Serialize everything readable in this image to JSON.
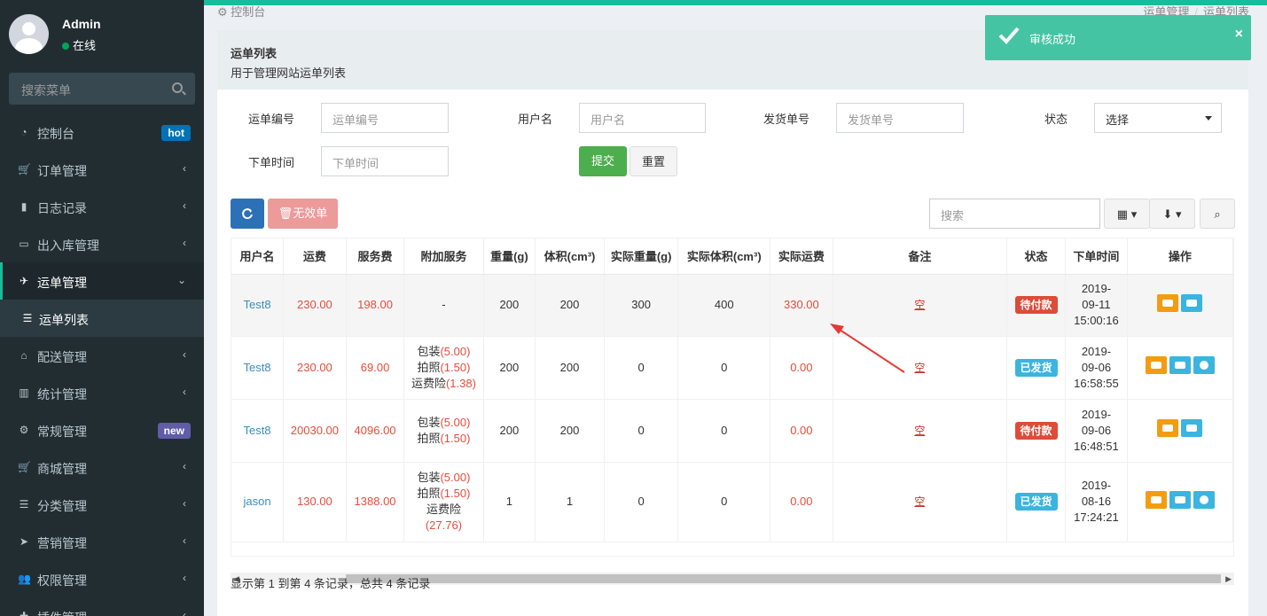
{
  "sidebar": {
    "user_name": "Admin",
    "user_status": "在线",
    "search_placeholder": "搜索菜单",
    "items": [
      {
        "label": "控制台",
        "icon": "dashboard-icon",
        "badge": "hot"
      },
      {
        "label": "订单管理",
        "icon": "cart-icon"
      },
      {
        "label": "日志记录",
        "icon": "book-icon"
      },
      {
        "label": "出入库管理",
        "icon": "inbox-icon"
      },
      {
        "label": "运单管理",
        "icon": "plane-icon",
        "active": true
      },
      {
        "label": "运单列表",
        "icon": "list-icon",
        "sub": true
      },
      {
        "label": "配送管理",
        "icon": "bank-icon"
      },
      {
        "label": "统计管理",
        "icon": "bar-chart-icon"
      },
      {
        "label": "常规管理",
        "icon": "cogs-icon",
        "badge": "new"
      },
      {
        "label": "商城管理",
        "icon": "cart-icon"
      },
      {
        "label": "分类管理",
        "icon": "list-icon"
      },
      {
        "label": "营销管理",
        "icon": "send-icon"
      },
      {
        "label": "权限管理",
        "icon": "users-icon"
      },
      {
        "label": "插件管理",
        "icon": "puzzle-icon"
      }
    ]
  },
  "breadcrumb": {
    "home": "控制台",
    "items": [
      "运单管理",
      "运单列表"
    ]
  },
  "panel": {
    "title": "运单列表",
    "desc": "用于管理网站运单列表"
  },
  "filters": {
    "waybill_no_label": "运单编号",
    "waybill_no_placeholder": "运单编号",
    "username_label": "用户名",
    "username_placeholder": "用户名",
    "ship_no_label": "发货单号",
    "ship_no_placeholder": "发货单号",
    "status_label": "状态",
    "status_value": "选择",
    "order_time_label": "下单时间",
    "order_time_placeholder": "下单时间",
    "submit": "提交",
    "reset": "重置"
  },
  "toolbar": {
    "invalid": "无效单",
    "search_placeholder": "搜索"
  },
  "table": {
    "columns": [
      "用户名",
      "运费",
      "服务费",
      "附加服务",
      "重量(g)",
      "体积(cm³)",
      "实际重量(g)",
      "实际体积(cm³)",
      "实际运费",
      "备注",
      "状态",
      "下单时间",
      "操作"
    ],
    "rows": [
      {
        "user": "Test8",
        "freight": "230.00",
        "service": "198.00",
        "extra": [
          {
            "t": "-"
          }
        ],
        "weight": "200",
        "volume": "200",
        "real_weight": "300",
        "real_volume": "400",
        "real_freight": "330.00",
        "remark": "空",
        "status": "待付款",
        "status_color": "red",
        "date": "2019-",
        "date2": "09-11",
        "time": "15:00:16",
        "ops": [
          "comment",
          "truck"
        ]
      },
      {
        "user": "Test8",
        "freight": "230.00",
        "service": "69.00",
        "extra": [
          {
            "t": "包装",
            "v": "(5.00)"
          },
          {
            "t": "拍照",
            "v": "(1.50)"
          },
          {
            "t": "运费险",
            "v": "(1.38)"
          }
        ],
        "weight": "200",
        "volume": "200",
        "real_weight": "0",
        "real_volume": "0",
        "real_freight": "0.00",
        "remark": "空",
        "status": "已发货",
        "status_color": "blue",
        "date": "2019-",
        "date2": "09-06",
        "time": "16:58:55",
        "ops": [
          "comment",
          "truck",
          "refresh"
        ]
      },
      {
        "user": "Test8",
        "freight": "20030.00",
        "service": "4096.00",
        "extra": [
          {
            "t": "包装",
            "v": "(5.00)"
          },
          {
            "t": "拍照",
            "v": "(1.50)"
          }
        ],
        "weight": "200",
        "volume": "200",
        "real_weight": "0",
        "real_volume": "0",
        "real_freight": "0.00",
        "remark": "空",
        "status": "待付款",
        "status_color": "red",
        "date": "2019-",
        "date2": "09-06",
        "time": "16:48:51",
        "ops": [
          "comment",
          "truck"
        ]
      },
      {
        "user": "jason",
        "freight": "130.00",
        "service": "1388.00",
        "extra": [
          {
            "t": "包装",
            "v": "(5.00)"
          },
          {
            "t": "拍照",
            "v": "(1.50)"
          },
          {
            "t": "运费险",
            "v": ""
          },
          {
            "t": "",
            "v": "(27.76)"
          }
        ],
        "weight": "1",
        "volume": "1",
        "real_weight": "0",
        "real_volume": "0",
        "real_freight": "0.00",
        "remark": "空",
        "status": "已发货",
        "status_color": "blue",
        "date": "2019-",
        "date2": "08-16",
        "time": "17:24:21",
        "ops": [
          "comment",
          "truck",
          "refresh"
        ]
      }
    ]
  },
  "pager_text": "显示第 1 到第 4 条记录，总共 4 条记录",
  "toast": {
    "message": "审核成功",
    "close": "×"
  },
  "colors": {
    "sidebar_bg": "#222d32",
    "accent": "#18bc9c",
    "toast_bg": "#45c4a3",
    "danger": "#dd4b39",
    "info": "#3bb4e0",
    "warning": "#f39c12",
    "money_red": "#e74c3c"
  }
}
